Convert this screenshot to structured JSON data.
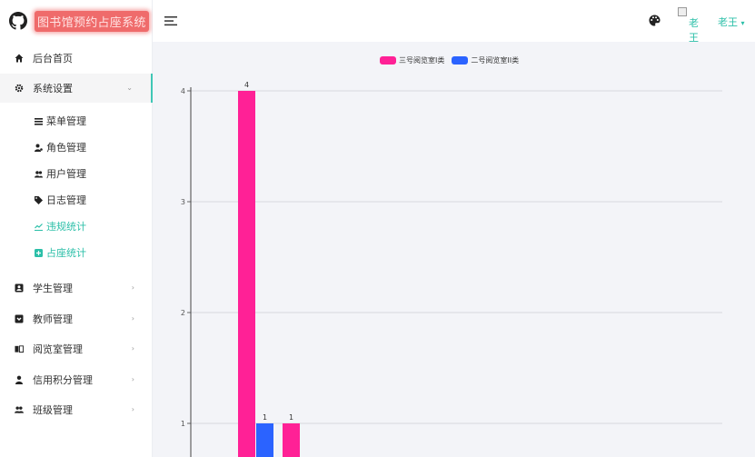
{
  "app": {
    "title": "图书馆预约占座系统"
  },
  "sidebar": {
    "items": [
      {
        "label": "后台首页"
      },
      {
        "label": "系统设置"
      },
      {
        "label": "学生管理"
      },
      {
        "label": "教师管理"
      },
      {
        "label": "阅览室管理"
      },
      {
        "label": "信用积分管理"
      },
      {
        "label": "班级管理"
      }
    ],
    "submenu": [
      {
        "label": "菜单管理"
      },
      {
        "label": "角色管理"
      },
      {
        "label": "用户管理"
      },
      {
        "label": "日志管理"
      },
      {
        "label": "违规统计"
      },
      {
        "label": "占座统计"
      }
    ]
  },
  "header": {
    "avatar_alt": "老王",
    "user_name": "老王",
    "dropdown_caret": "▾"
  },
  "colors": {
    "accent": "#2bbfa8",
    "series1": "#ff2196",
    "series2": "#2b63ff",
    "brand_bg": "#ef6b6b"
  },
  "chart_data": {
    "type": "bar",
    "categories": [
      "",
      "",
      ""
    ],
    "series": [
      {
        "name": "三号阅览室I类",
        "values": [
          4,
          null,
          1
        ]
      },
      {
        "name": "二号阅览室II类",
        "values": [
          null,
          1,
          null
        ]
      }
    ],
    "ylim": [
      0,
      4
    ],
    "yticks": [
      "1",
      "2",
      "3",
      "4"
    ],
    "grid": true,
    "legend": "top-center"
  }
}
